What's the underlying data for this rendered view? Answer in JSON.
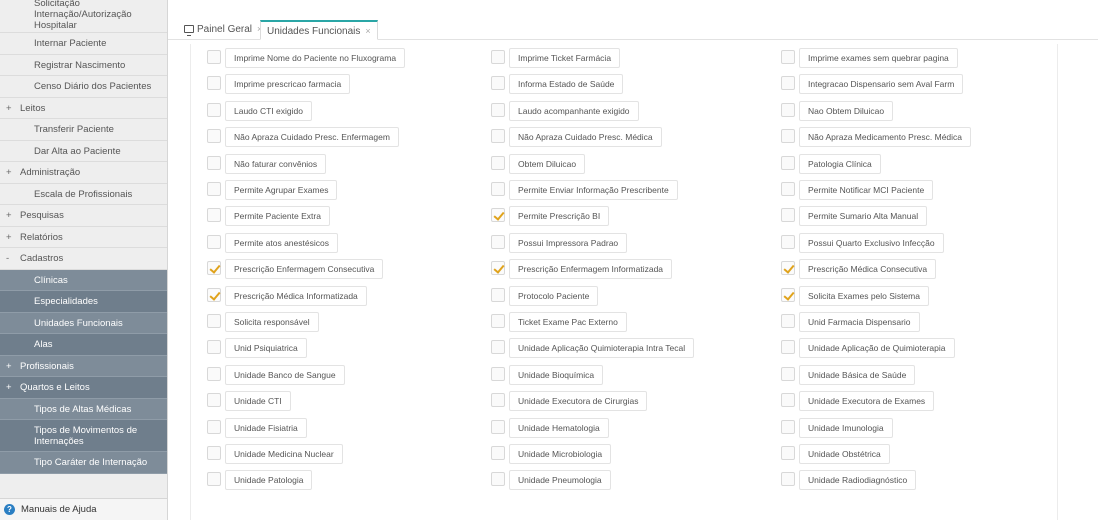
{
  "sidebar": {
    "top_item": "Solicitação Internação/Autorização Hospitalar",
    "items": [
      {
        "label": "Internar Paciente"
      },
      {
        "label": "Registrar Nascimento"
      },
      {
        "label": "Censo Diário dos Pacientes"
      },
      {
        "label": "Leitos",
        "prefix": "+"
      },
      {
        "label": "Transferir Paciente"
      },
      {
        "label": "Dar Alta ao Paciente"
      },
      {
        "label": "Administração",
        "prefix": "+"
      },
      {
        "label": "Escala de Profissionais"
      },
      {
        "label": "Pesquisas",
        "prefix": "+"
      },
      {
        "label": "Relatórios",
        "prefix": "+"
      },
      {
        "label": "Cadastros",
        "prefix": "-"
      }
    ],
    "sub_items": [
      {
        "label": "Clínicas"
      },
      {
        "label": "Especialidades"
      },
      {
        "label": "Unidades Funcionais"
      },
      {
        "label": "Alas"
      },
      {
        "label": "Profissionais",
        "prefix": "+"
      },
      {
        "label": "Quartos e Leitos",
        "prefix": "+"
      },
      {
        "label": "Tipos de Altas Médicas"
      },
      {
        "label": "Tipos de Movimentos de Internações"
      },
      {
        "label": "Tipo Caráter de Internação"
      }
    ],
    "footer": "Manuais de Ajuda"
  },
  "tabs": [
    {
      "label": "Painel Geral",
      "close": "×",
      "icon": "monitor-icon"
    },
    {
      "label": "Unidades Funcionais",
      "close": "×",
      "active": true
    }
  ],
  "options": [
    [
      "Imprime Nome do Paciente no Fluxograma",
      "Imprime Ticket Farmácia",
      "Imprime exames sem quebrar pagina"
    ],
    [
      "Imprime prescricao farmacia",
      "Informa Estado de Saúde",
      "Integracao Dispensario sem Aval Farm"
    ],
    [
      "Laudo CTI exigido",
      "Laudo acompanhante exigido",
      "Nao Obtem Diluicao"
    ],
    [
      "Não Apraza Cuidado Presc. Enfermagem",
      "Não Apraza Cuidado Presc. Médica",
      "Não Apraza Medicamento Presc. Médica"
    ],
    [
      "Não faturar convênios",
      "Obtem Diluicao",
      "Patologia Clínica"
    ],
    [
      "Permite Agrupar Exames",
      "Permite Enviar Informação Prescribente",
      "Permite Notificar MCI Paciente"
    ],
    [
      "Permite Paciente Extra",
      "Permite Prescrição BI",
      "Permite Sumario Alta Manual"
    ],
    [
      "Permite atos anestésicos",
      "Possui Impressora Padrao",
      "Possui Quarto Exclusivo Infecção"
    ],
    [
      "Prescrição Enfermagem Consecutiva",
      "Prescrição Enfermagem Informatizada",
      "Prescrição Médica Consecutiva"
    ],
    [
      "Prescrição Médica Informatizada",
      "Protocolo Paciente",
      "Solicita Exames pelo Sistema"
    ],
    [
      "Solicita responsável",
      "Ticket Exame Pac Externo",
      "Unid Farmacia Dispensario"
    ],
    [
      "Unid Psiquiatrica",
      "Unidade Aplicação Quimioterapia Intra Tecal",
      "Unidade Aplicação de Quimioterapia"
    ],
    [
      "Unidade Banco de Sangue",
      "Unidade Bioquímica",
      "Unidade Básica de Saúde"
    ],
    [
      "Unidade CTI",
      "Unidade Executora de Cirurgias",
      "Unidade Executora de Exames"
    ],
    [
      "Unidade Fisiatria",
      "Unidade Hematologia",
      "Unidade Imunologia"
    ],
    [
      "Unidade Medicina Nuclear",
      "Unidade Microbiologia",
      "Unidade Obstétrica"
    ],
    [
      "Unidade Patologia",
      "Unidade Pneumologia",
      "Unidade Radiodiagnóstico"
    ]
  ],
  "checked": [
    [
      false,
      false,
      false
    ],
    [
      false,
      false,
      false
    ],
    [
      false,
      false,
      false
    ],
    [
      false,
      false,
      false
    ],
    [
      false,
      false,
      false
    ],
    [
      false,
      false,
      false
    ],
    [
      false,
      true,
      false
    ],
    [
      false,
      false,
      false
    ],
    [
      true,
      true,
      true
    ],
    [
      true,
      false,
      true
    ],
    [
      false,
      false,
      false
    ],
    [
      false,
      false,
      false
    ],
    [
      false,
      false,
      false
    ],
    [
      false,
      false,
      false
    ],
    [
      false,
      false,
      false
    ],
    [
      false,
      false,
      false
    ],
    [
      false,
      false,
      false
    ]
  ],
  "colors": {
    "accent": "#2aa6a6",
    "check": "#e0a31c",
    "submenu": "#7e8c99"
  }
}
